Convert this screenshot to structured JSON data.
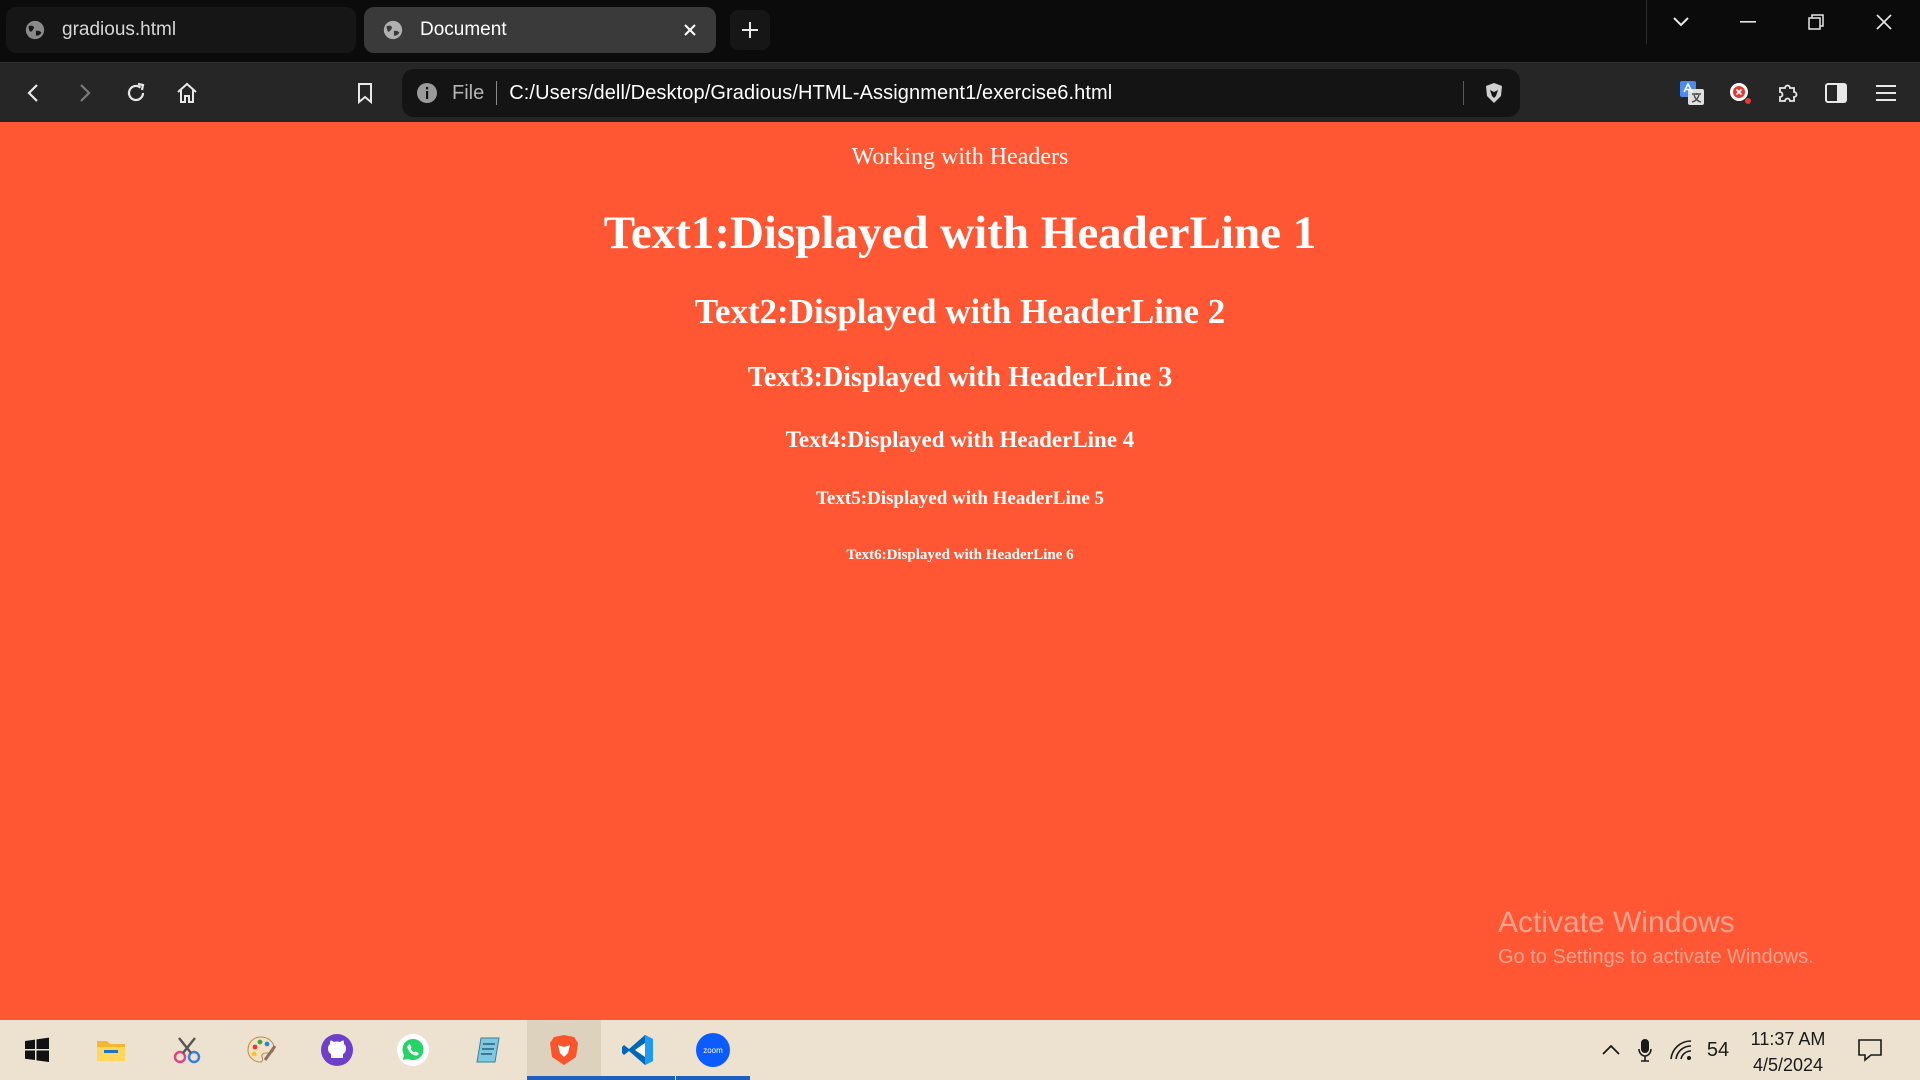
{
  "browser": {
    "tabs": [
      {
        "title": "gradious.html",
        "active": false
      },
      {
        "title": "Document",
        "active": true
      }
    ],
    "address_bar": {
      "scheme_label": "File",
      "url": "C:/Users/dell/Desktop/Gradious/HTML-Assignment1/exercise6.html"
    }
  },
  "page": {
    "background": "#ff5733",
    "intro": "Working with Headers",
    "headings": [
      "Text1:Displayed with HeaderLine 1",
      "Text2:Displayed with HeaderLine 2",
      "Text3:Displayed with HeaderLine 3",
      "Text4:Displayed with HeaderLine 4",
      "Text5:Displayed with HeaderLine 5",
      "Text6:Displayed with HeaderLine 6"
    ]
  },
  "watermark": {
    "title": "Activate Windows",
    "subtitle": "Go to Settings to activate Windows."
  },
  "taskbar": {
    "apps": [
      "windows-start",
      "file-explorer",
      "snipping-tool",
      "paint",
      "github-desktop",
      "whatsapp",
      "notepad",
      "brave-browser",
      "vs-code",
      "zoom"
    ],
    "zoom_label": "zoom",
    "tray": {
      "battery_level": "54",
      "time": "11:37 AM",
      "date": "4/5/2024"
    }
  },
  "colors": {
    "accent": "#1f5fbf",
    "page_bg": "#ff5733",
    "taskbar_bg": "#ece2cf",
    "brave": "#fb542b",
    "vscode": "#007acc",
    "zoom": "#0b5cff"
  }
}
